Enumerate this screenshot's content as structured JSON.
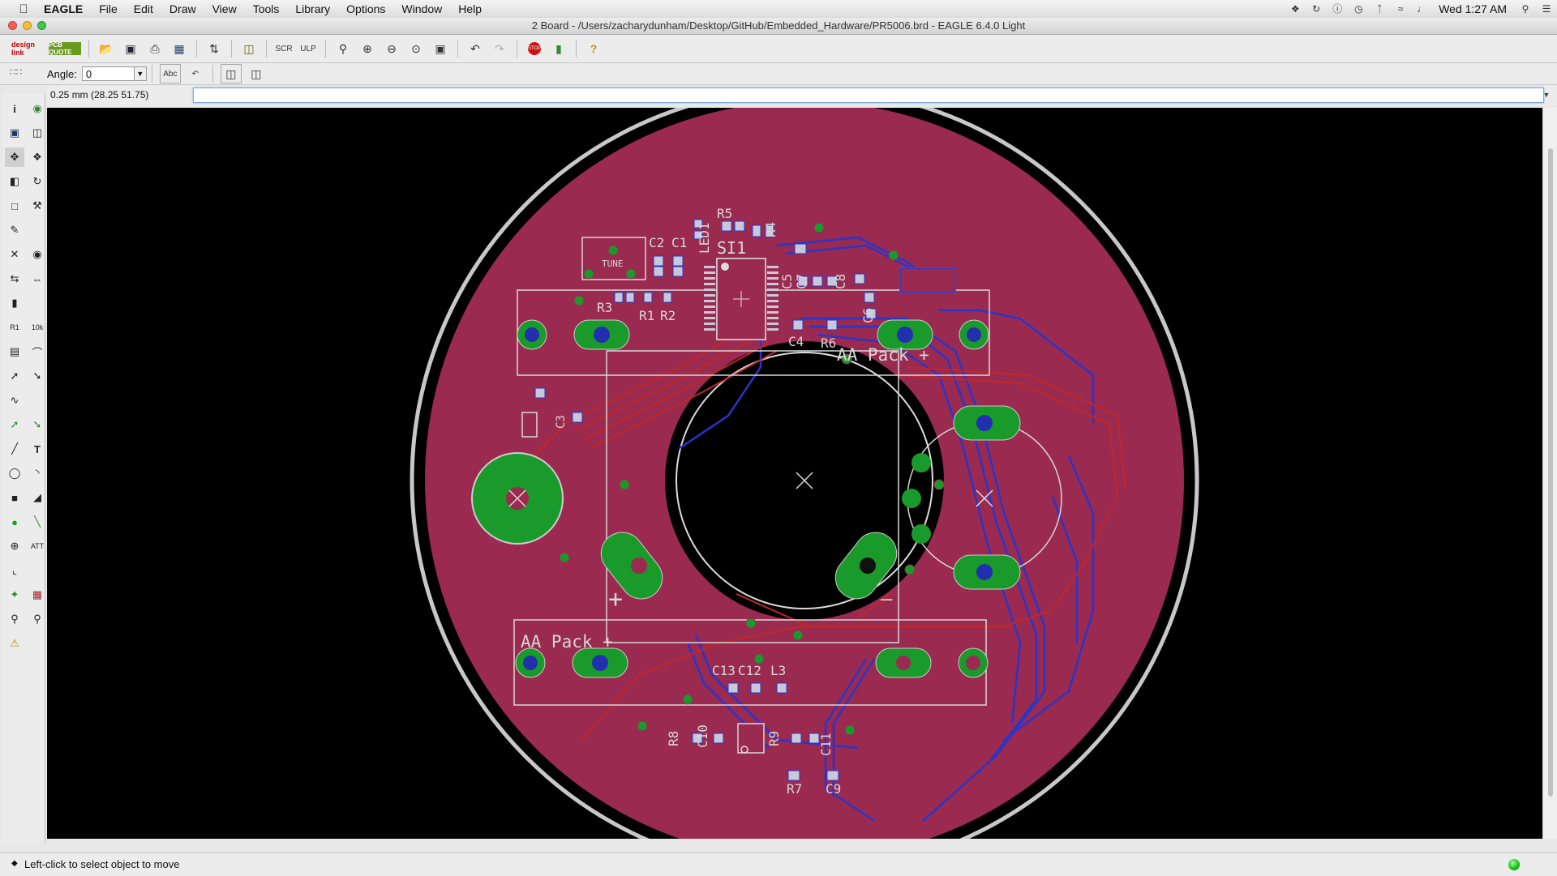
{
  "menubar": {
    "apple": "",
    "app": "EAGLE",
    "items": [
      "File",
      "Edit",
      "Draw",
      "View",
      "Tools",
      "Library",
      "Options",
      "Window",
      "Help"
    ],
    "clock": "Wed 1:27 AM",
    "tray_icons": [
      "dropbox-icon",
      "sync-icon",
      "help-icon",
      "time-machine-icon",
      "bluetooth-icon",
      "wifi-icon",
      "volume-icon",
      "spotlight-icon",
      "menu-list-icon"
    ]
  },
  "window": {
    "title": "2 Board - /Users/zacharydunham/Desktop/GitHub/Embedded_Hardware/PR5006.brd - EAGLE 6.4.0 Light"
  },
  "toolbar1": {
    "logo1": "design link",
    "logo2": "PCB QUOTE"
  },
  "toolbar2": {
    "angle_label": "Angle:",
    "angle_value": "0"
  },
  "command": {
    "coord_readout": "0.25 mm (28.25 51.75)",
    "input_value": ""
  },
  "status": {
    "message": "Left-click to select object to move"
  },
  "board": {
    "labels": {
      "tune": "TUNE",
      "si1": "SI1",
      "c2": "C2",
      "c1": "C1",
      "r5": "R5",
      "r4": "R4",
      "led1": "LED1",
      "r3": "R3",
      "r1": "R1",
      "r2": "R2",
      "c4": "C4",
      "r6": "R6",
      "c5": "C5",
      "c7": "C7",
      "c8": "C8",
      "c6": "C6",
      "aa_pack_top": "AA  Pack  +",
      "aa_pack_bottom": "AA  Pack  +",
      "c3": "C3",
      "plus": "+",
      "minus": "—",
      "c13": "C13",
      "c12": "C12",
      "l3": "L3",
      "r8": "R8",
      "c10": "C10",
      "r9": "R9",
      "c11": "C11",
      "r7": "R7",
      "c9": "C9"
    },
    "colors": {
      "copper_fill": "#9a2a50",
      "pad": "#1a9a2a",
      "drill": "#2230b0",
      "bottom_trace": "#2a35c8",
      "top_trace": "#c02828",
      "silk": "#d8d8d8"
    }
  }
}
